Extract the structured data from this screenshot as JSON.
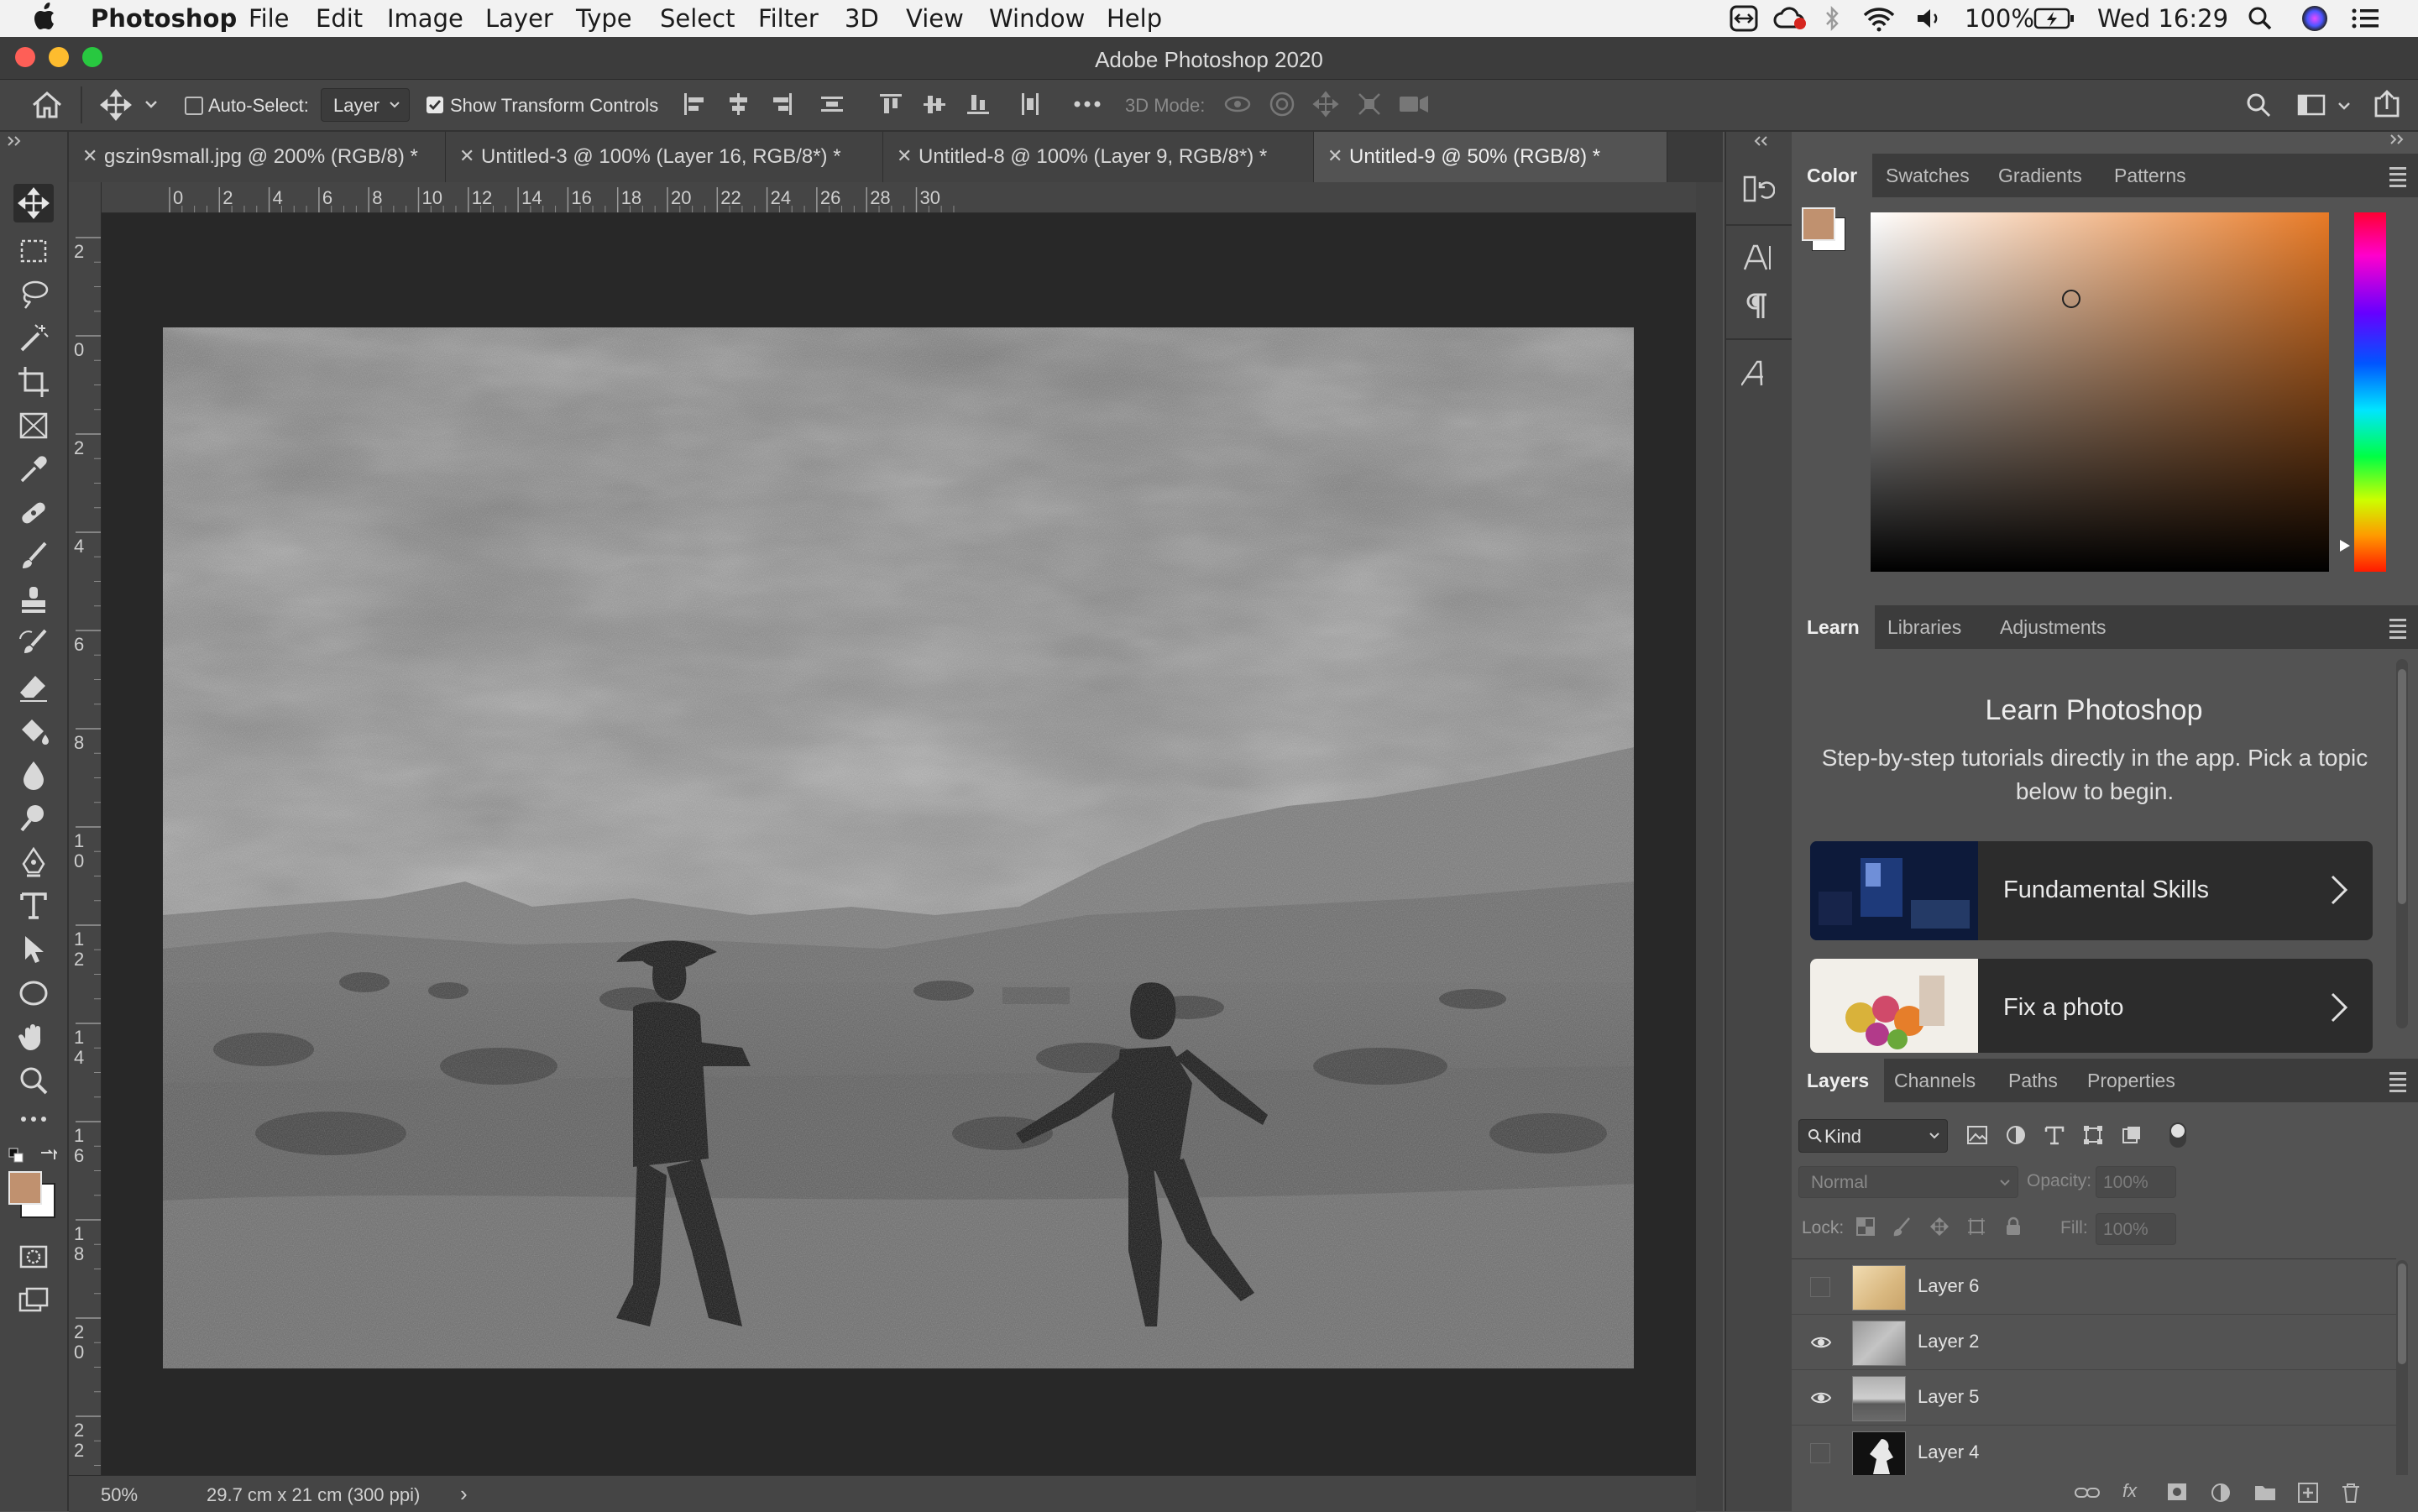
{
  "menubar": {
    "app": "Photoshop",
    "items": [
      "File",
      "Edit",
      "Image",
      "Layer",
      "Type",
      "Select",
      "Filter",
      "3D",
      "View",
      "Window",
      "Help"
    ],
    "battery": "100%",
    "clock": "Wed 16:29"
  },
  "window": {
    "title": "Adobe Photoshop 2020"
  },
  "options": {
    "auto_select_label": "Auto-Select:",
    "auto_select_value": "Layer",
    "show_transform_label": "Show Transform Controls",
    "mode3d_label": "3D Mode:"
  },
  "tabs": [
    {
      "label": "gszin9small.jpg @ 200% (RGB/8) *"
    },
    {
      "label": "Untitled-3 @ 100% (Layer 16, RGB/8*) *"
    },
    {
      "label": "Untitled-8 @ 100% (Layer 9, RGB/8*) *"
    },
    {
      "label": "Untitled-9 @ 50% (RGB/8) *"
    }
  ],
  "ruler": {
    "h_labels": [
      "0",
      "2",
      "4",
      "6",
      "8",
      "10",
      "12",
      "14",
      "16",
      "18",
      "20",
      "22",
      "24",
      "26",
      "28",
      "30"
    ],
    "v_labels": [
      "2",
      "0",
      "2",
      "4",
      "6",
      "8",
      "10",
      "12",
      "14",
      "16",
      "18",
      "20",
      "22"
    ]
  },
  "status": {
    "zoom": "50%",
    "doc_size": "29.7 cm x 21 cm (300 ppi)",
    "arrow": "›"
  },
  "colors": {
    "foreground": "#c0916f",
    "background": "#ffffff",
    "accent": "#e87a26"
  },
  "color_panel": {
    "tabs": [
      "Color",
      "Swatches",
      "Gradients",
      "Patterns"
    ]
  },
  "learn_panel": {
    "tabs": [
      "Learn",
      "Libraries",
      "Adjustments"
    ],
    "heading": "Learn Photoshop",
    "desc": "Step-by-step tutorials directly in the app. Pick a topic below to begin.",
    "cards": [
      {
        "title": "Fundamental Skills"
      },
      {
        "title": "Fix a photo"
      }
    ]
  },
  "layers_panel": {
    "tabs": [
      "Layers",
      "Channels",
      "Paths",
      "Properties"
    ],
    "filter_kind": "Kind",
    "blend_mode": "Normal",
    "opacity_label": "Opacity:",
    "opacity_value": "100%",
    "lock_label": "Lock:",
    "fill_label": "Fill:",
    "fill_value": "100%",
    "layers": [
      {
        "name": "Layer 6",
        "visible": false
      },
      {
        "name": "Layer 2",
        "visible": true
      },
      {
        "name": "Layer 5",
        "visible": true
      },
      {
        "name": "Layer 4",
        "visible": false
      }
    ]
  }
}
